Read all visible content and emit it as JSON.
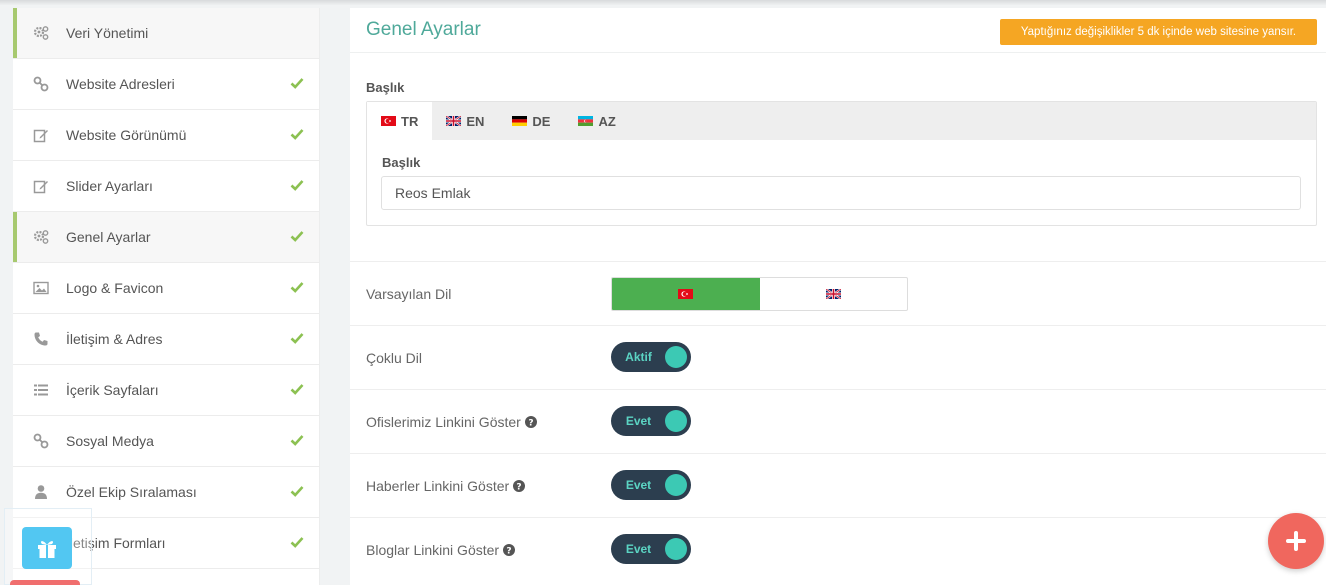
{
  "sidebar": {
    "items": [
      {
        "label": "Veri Yönetimi",
        "icon": "gears-icon",
        "active": true,
        "check": false
      },
      {
        "label": "Website Adresleri",
        "icon": "link-icon",
        "active": false,
        "check": true
      },
      {
        "label": "Website Görünümü",
        "icon": "edit-icon",
        "active": false,
        "check": true
      },
      {
        "label": "Slider Ayarları",
        "icon": "edit-icon",
        "active": false,
        "check": true
      },
      {
        "label": "Genel Ayarlar",
        "icon": "gears-icon",
        "active": true,
        "check": true
      },
      {
        "label": "Logo & Favicon",
        "icon": "image-icon",
        "active": false,
        "check": true
      },
      {
        "label": "İletişim & Adres",
        "icon": "phone-icon",
        "active": false,
        "check": true
      },
      {
        "label": "İçerik Sayfaları",
        "icon": "list-icon",
        "active": false,
        "check": true
      },
      {
        "label": "Sosyal Medya",
        "icon": "link-icon",
        "active": false,
        "check": true
      },
      {
        "label": "Özel Ekip Sıralaması",
        "icon": "user-icon",
        "active": false,
        "check": true
      },
      {
        "label": "İletişim Formları",
        "icon": "envelope-icon",
        "active": false,
        "check": true
      }
    ]
  },
  "header": {
    "title": "Genel Ayarlar",
    "notice": "Yaptığınız değişiklikler 5 dk içinde web sitesine yansır."
  },
  "title_section": {
    "label": "Başlık",
    "tabs": [
      {
        "code": "TR",
        "flag": "flag-tr-icon",
        "active": true
      },
      {
        "code": "EN",
        "flag": "flag-uk-icon",
        "active": false
      },
      {
        "code": "DE",
        "flag": "flag-de-icon",
        "active": false
      },
      {
        "code": "AZ",
        "flag": "flag-az-icon",
        "active": false
      }
    ],
    "field_label": "Başlık",
    "field_value": "Reos Emlak"
  },
  "settings": {
    "default_language": {
      "label": "Varsayılan Dil",
      "selected": "TR"
    },
    "multi_language": {
      "label": "Çoklu Dil",
      "value": "Aktif"
    },
    "offices_link": {
      "label": "Ofislerimiz Linkini Göster",
      "value": "Evet"
    },
    "news_link": {
      "label": "Haberler Linkini Göster",
      "value": "Evet"
    },
    "blogs_link": {
      "label": "Bloglar Linkini Göster",
      "value": "Evet"
    }
  },
  "colors": {
    "accent": "#4fa99a",
    "notice": "#f5a623",
    "active_lang": "#4caf50",
    "switch_bg": "#2c3e4f",
    "switch_knob": "#3cc9b4",
    "fab": "#f0675e",
    "gift": "#52c7f2"
  }
}
